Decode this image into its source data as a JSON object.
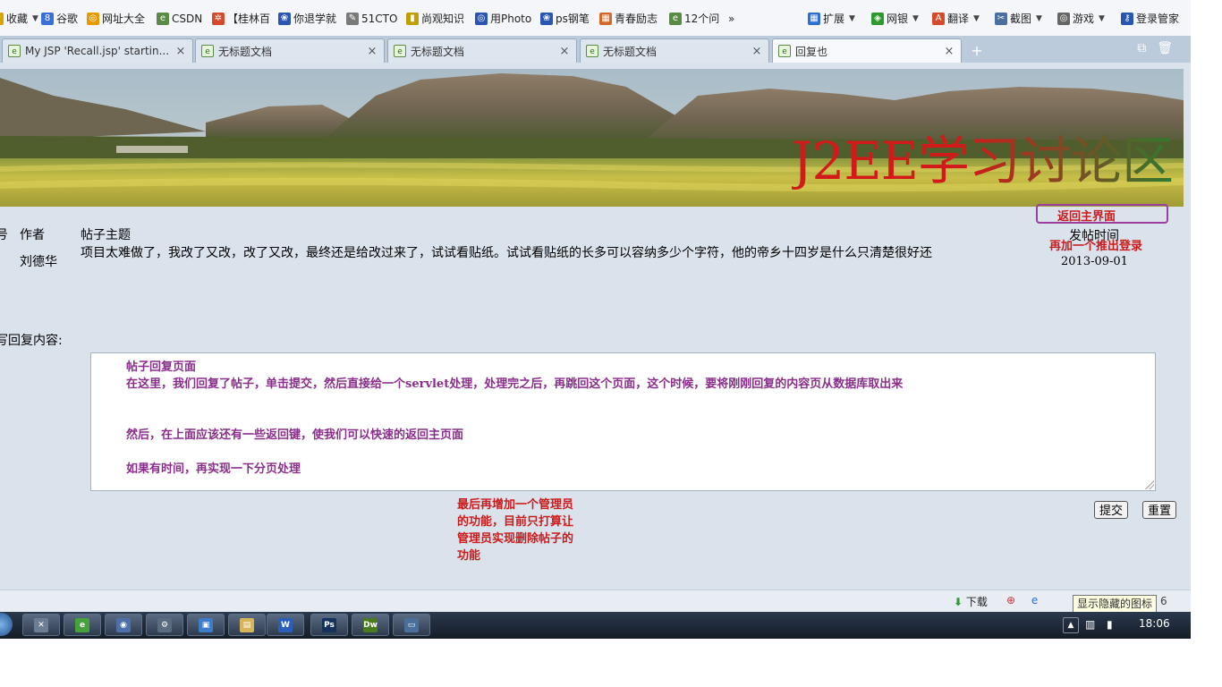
{
  "bookmarks": {
    "left": [
      {
        "label": "收藏",
        "icon": "star-icon",
        "color": "#d9a400"
      },
      {
        "label": "谷歌",
        "icon": "google-icon",
        "color": "#3b6ed6"
      },
      {
        "label": "网址大全",
        "icon": "sogou-icon",
        "color": "#e69a00"
      },
      {
        "label": "CSDN",
        "icon": "page-icon",
        "color": "#5a8a45"
      },
      {
        "label": "【桂林百",
        "icon": "network-icon",
        "color": "#d44a2a"
      },
      {
        "label": "你退学就",
        "icon": "paw-icon",
        "color": "#2a55b0"
      },
      {
        "label": "51CTO",
        "icon": "pen-icon",
        "color": "#7a7a7a"
      },
      {
        "label": "尚观知识",
        "icon": "book-icon",
        "color": "#c0a000"
      },
      {
        "label": "用Photo",
        "icon": "globe-icon",
        "color": "#2a55b0"
      },
      {
        "label": "ps钢笔",
        "icon": "paw-icon",
        "color": "#2a55b0"
      },
      {
        "label": "青春励志",
        "icon": "calendar-icon",
        "color": "#d46a2a"
      },
      {
        "label": "12个问",
        "icon": "page-icon",
        "color": "#5a8a45"
      }
    ],
    "more": "»",
    "right": [
      {
        "label": "扩展",
        "icon": "grid-icon",
        "color": "#2d6fd0"
      },
      {
        "label": "网银",
        "icon": "shield-icon",
        "color": "#2e9a2e"
      },
      {
        "label": "翻译",
        "icon": "translate-icon",
        "color": "#d44a2a"
      },
      {
        "label": "截图",
        "icon": "scissors-icon",
        "color": "#4a6fa0"
      },
      {
        "label": "游戏",
        "icon": "gamepad-icon",
        "color": "#666666"
      },
      {
        "label": "登录管家",
        "icon": "key-icon",
        "color": "#2a55b0"
      }
    ]
  },
  "tabs": [
    {
      "title": "My JSP 'Recall.jsp' startin...",
      "close": "×",
      "active": false
    },
    {
      "title": "无标题文档",
      "close": "×",
      "active": false
    },
    {
      "title": "无标题文档",
      "close": "×",
      "active": false
    },
    {
      "title": "无标题文档",
      "close": "×",
      "active": false
    },
    {
      "title": "回复也",
      "close": "×",
      "active": true
    }
  ],
  "new_tab": "+",
  "banner": {
    "title": "J2EE学习讨论区"
  },
  "nav": {
    "back_main": "返回主界面",
    "logout": "再加一个推出登录"
  },
  "post": {
    "col_no": "号",
    "col_author": "作者",
    "col_subject": "帖子主题",
    "col_time": "发帖时间",
    "author": "刘德华",
    "body": "项目太难做了，我改了又改，改了又改，最终还是给改过来了，试试看贴纸。试试看贴纸的长多可以容纳多少个字符，他的帝乡十四岁是什么只清楚很好还",
    "time": "2013-09-01"
  },
  "reply": {
    "label": "写回复内容:",
    "lines": [
      "帖子回复页面",
      "在这里，我们回复了帖子，单击提交，然后直接给一个servlet处理，处理完之后，再跳回这个页面，这个时候，要将刚刚回复的内容页从数据库取出来",
      "然后，在上面应该还有一些返回键，使我们可以快速的返回主页面",
      "如果有时间，再实现一下分页处理"
    ],
    "submit": "提交",
    "reset": "重置"
  },
  "admin_note": "最后再增加一个管理员的功能，目前只打算让管理员实现删除帖子的功能",
  "statusbar": {
    "download": "下载",
    "tooltip": "显示隐藏的图标",
    "trailing": "6"
  },
  "taskbar": {
    "apps": [
      {
        "name": "desktop",
        "label": "✕",
        "bg": "#6d7d92"
      },
      {
        "name": "browser",
        "label": "e",
        "bg": "#46a23c"
      },
      {
        "name": "media",
        "label": "◉",
        "bg": "#4f6fa8"
      },
      {
        "name": "tool",
        "label": "⚙",
        "bg": "#5b6b80"
      },
      {
        "name": "monitor",
        "label": "▣",
        "bg": "#3d7cc9"
      },
      {
        "name": "explorer",
        "label": "▤",
        "bg": "#d8b45a"
      },
      {
        "name": "word",
        "label": "W",
        "bg": "#2b5eb8"
      },
      {
        "name": "photoshop",
        "label": "Ps",
        "bg": "#13325c"
      },
      {
        "name": "dreamweaver",
        "label": "Dw",
        "bg": "#4a7b1e"
      },
      {
        "name": "window",
        "label": "▭",
        "bg": "#4a6f9a"
      }
    ],
    "clock": "18:06"
  },
  "colors": {
    "banner_title_red": "#d21a1a",
    "banner_title_green": "#2f7a2f",
    "link_red": "#cc1b1b",
    "note_purple": "#8a2e8b",
    "page_bg": "#dae2ec"
  }
}
